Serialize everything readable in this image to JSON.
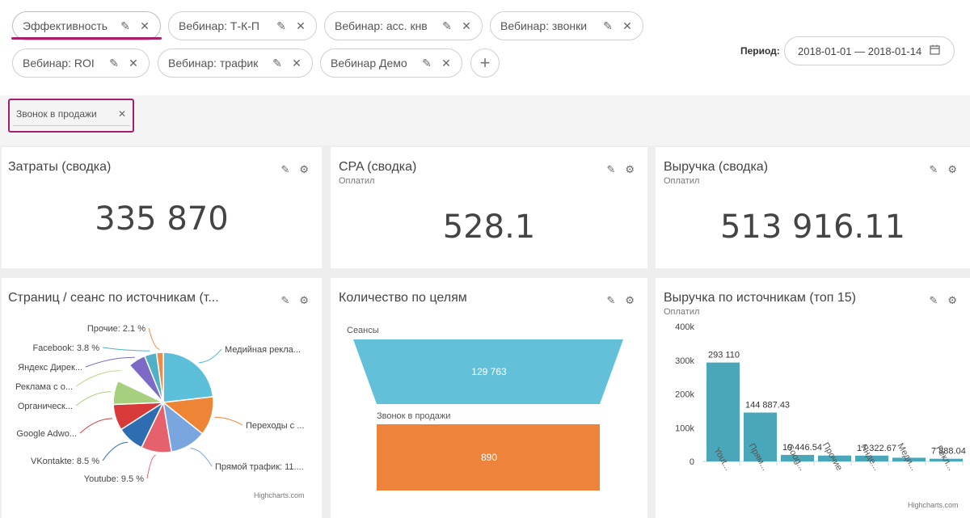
{
  "tabs": [
    {
      "label": "Эффективность",
      "active": true
    },
    {
      "label": "Вебинар: Т-К-П"
    },
    {
      "label": "Вебинар: асс. кнв"
    },
    {
      "label": "Вебинар: звонки"
    },
    {
      "label": "Вебинар: ROI"
    },
    {
      "label": "Вебинар: трафик"
    },
    {
      "label": "Вебинар Демо"
    }
  ],
  "add_tab": "+",
  "period": {
    "label": "Период:",
    "value": "2018-01-01 — 2018-01-14"
  },
  "filter": {
    "label": "Звонок в продажи"
  },
  "accent_color": "#a3206c",
  "panels": {
    "costs": {
      "title": "Затраты (сводка)",
      "value": "335 870"
    },
    "cpa": {
      "title": "CPA (сводка)",
      "subtitle": "Оплатил",
      "value": "528.1"
    },
    "revenue": {
      "title": "Выручка (сводка)",
      "subtitle": "Оплатил",
      "value": "513 916.11"
    },
    "pages": {
      "title": "Страниц / сеанс по источникам (т...",
      "credit": "Highcharts.com"
    },
    "goals": {
      "title": "Количество по целям"
    },
    "revsrc": {
      "title": "Выручка по источникам (топ 15)",
      "subtitle": "Оплатил",
      "credit": "Highcharts.com"
    }
  },
  "chart_data": [
    {
      "type": "pie",
      "labels": [
        "Медийная рекла...",
        "Переходы с ...",
        "Прямой трафик: 11....",
        "Youtube: 9.5 %",
        "VKontakte: 8.5 %",
        "Google Adwo...",
        "Органическ...",
        "Реклама с о...",
        "Яндекс Дирек...",
        "Facebook: 3.8 %",
        "Прочие: 2.1 %"
      ],
      "values": [
        22.5,
        12.2,
        11.3,
        9.5,
        8.5,
        8.2,
        7.5,
        6.0,
        5.5,
        3.8,
        2.1
      ],
      "colors": [
        "#5bbfd9",
        "#ee8436",
        "#7aa6e0",
        "#e5626c",
        "#2f6db3",
        "#d83a3a",
        "#a6d07e",
        "#ffffff",
        "#7d6ac7",
        "#4fb0c6",
        "#e88d4a"
      ]
    },
    {
      "type": "funnel",
      "categories": [
        "Сеансы",
        "Звонок в продажи"
      ],
      "values": [
        129763,
        890
      ],
      "value_labels": [
        "129 763",
        "890"
      ],
      "colors": [
        "#62c1d9",
        "#ee843c"
      ]
    },
    {
      "type": "bar",
      "categories": [
        "Yout...",
        "Прям...",
        "Goog...",
        "Прочие",
        "Яндe...",
        "Меди...",
        "Рекл..."
      ],
      "values": [
        293110,
        144887.43,
        19446.54,
        17500,
        17322.67,
        11000,
        7888.04
      ],
      "data_labels": [
        "293 110",
        "144 887.43",
        "19 446.54",
        "",
        "17 322.67",
        "",
        "7 888.04"
      ],
      "ylim": [
        0,
        400000
      ],
      "yticks": [
        "0",
        "100k",
        "200k",
        "300k",
        "400k"
      ],
      "color": "#4aa7ba"
    }
  ]
}
